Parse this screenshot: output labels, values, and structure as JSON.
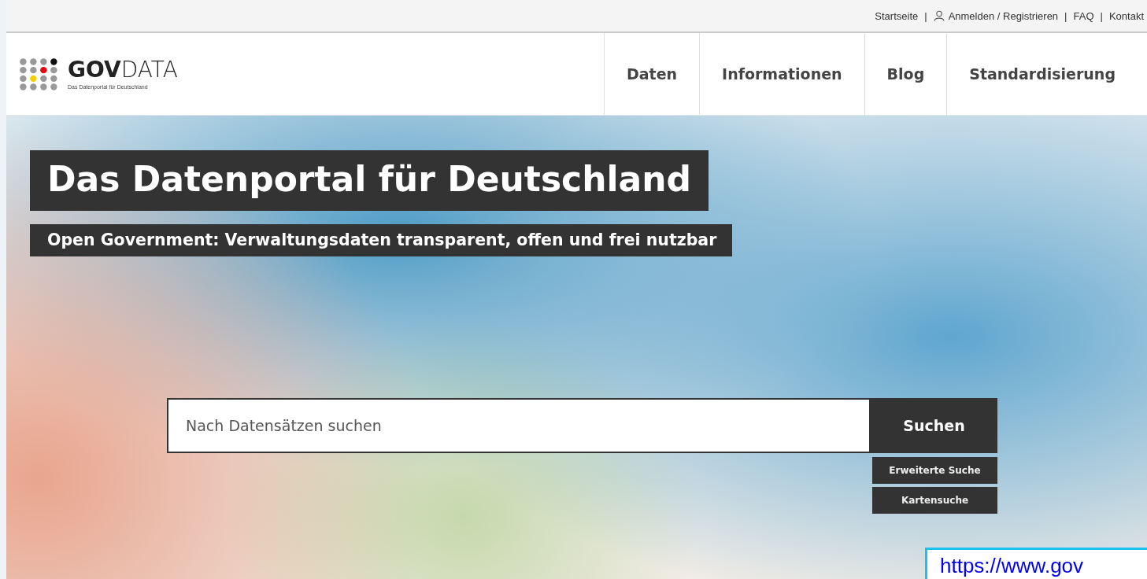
{
  "top_bar": {
    "items": [
      {
        "kind": "link",
        "text": "Startseite"
      },
      {
        "kind": "separator",
        "text": "|"
      },
      {
        "kind": "user_link",
        "text": "Anmelden / Registrieren"
      },
      {
        "kind": "separator",
        "text": "|"
      },
      {
        "kind": "link",
        "text": "FAQ"
      },
      {
        "kind": "separator",
        "text": "|"
      },
      {
        "kind": "link",
        "text": "Kontakt"
      }
    ]
  },
  "header": {
    "logo": {
      "wordmark": "**GOV**DATA",
      "tagline": "Das Datenportal für Deutschland"
    },
    "nav": [
      {
        "label": "Daten"
      },
      {
        "label": "Informationen"
      },
      {
        "label": "Blog"
      },
      {
        "label": "Standardisierung"
      }
    ]
  },
  "hero": {
    "title": "Das Datenportal für Deutschland",
    "subtitle": "Open Government: Verwaltungsdaten transparent, offen und frei nutzbar",
    "search": {
      "placeholder": "Nach Datensätzen suchen",
      "button": "Suchen"
    },
    "links": [
      "Erweiterte Suche",
      "Kartensuche"
    ]
  },
  "url_overlay": {
    "text": "https://www.gov"
  }
}
